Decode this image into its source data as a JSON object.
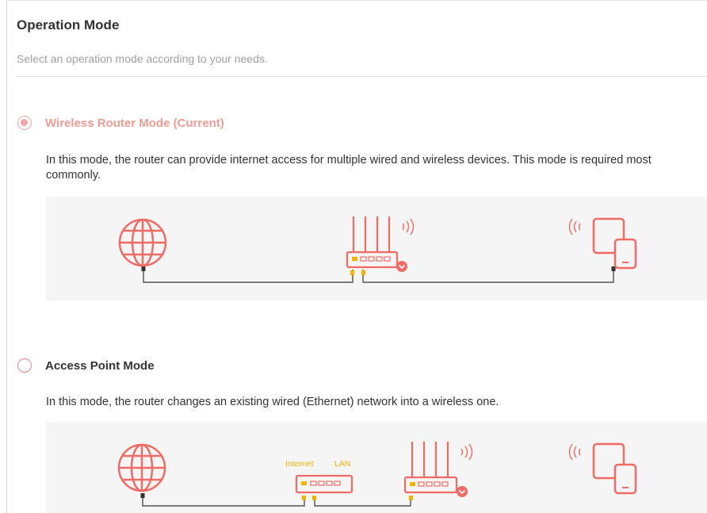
{
  "header": {
    "title": "Operation Mode",
    "subtitle": "Select an operation mode according to your needs."
  },
  "modes": [
    {
      "label": "Wireless Router Mode (Current)",
      "selected": true,
      "description": "In this mode, the router can provide internet access for multiple wired and wireless devices. This mode is required most commonly.",
      "diagram_icons": [
        "globe-icon",
        "router-icon",
        "devices-icon"
      ]
    },
    {
      "label": "Access Point Mode",
      "selected": false,
      "description": "In this mode, the router changes an existing wired (Ethernet) network into a wireless one.",
      "diagram_labels": {
        "internet": "Internet",
        "lan": "LAN"
      },
      "diagram_icons": [
        "globe-icon",
        "modem-icon",
        "router-icon",
        "devices-icon"
      ]
    }
  ],
  "colors": {
    "accent": "#f06b64",
    "accent_light": "#f3a7a2",
    "port_yellow": "#f5b400",
    "text": "#333333",
    "muted": "#a0a0a0"
  }
}
